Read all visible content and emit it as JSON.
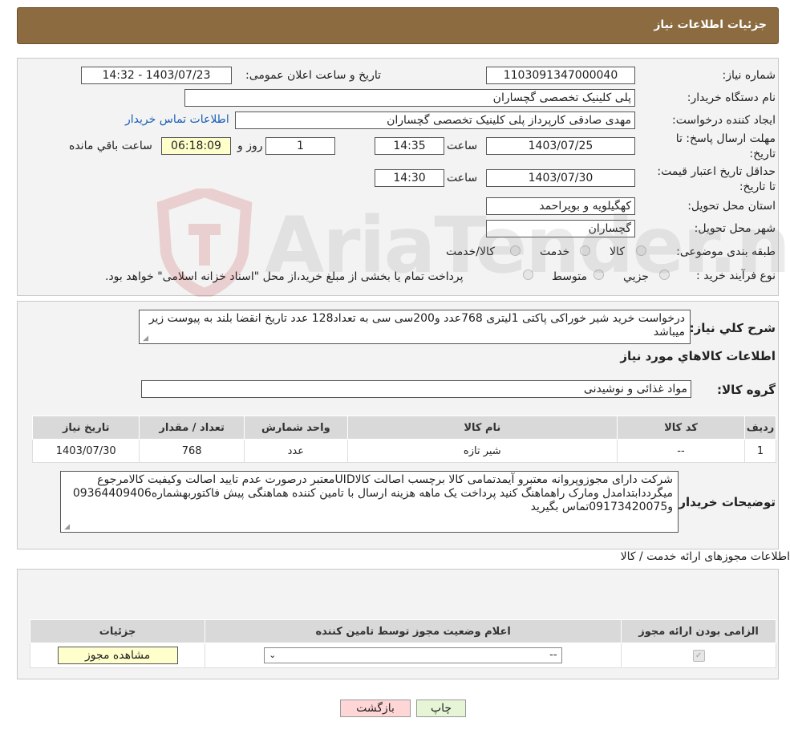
{
  "header": {
    "title": "جزئیات اطلاعات نیاز"
  },
  "info": {
    "need_number_label": "شماره نیاز:",
    "need_number": "1103091347000040",
    "announce_label": "تاریخ و ساعت اعلان عمومی:",
    "announce_value": "1403/07/23 - 14:32",
    "buyer_label": "نام دستگاه خریدار:",
    "buyer_value": "پلی کلینیک تخصصی گچساران",
    "creator_label": "ایجاد کننده درخواست:",
    "creator_value": "مهدی صادقی کارپرداز پلی کلینیک تخصصی گچساران",
    "contact_link": "اطلاعات تماس خریدار",
    "deadline_label": "مهلت ارسال پاسخ: تا تاریخ:",
    "deadline_date": "1403/07/25",
    "time_label": "ساعت",
    "deadline_time": "14:35",
    "days_value": "1",
    "days_label": "روز و",
    "remaining_value": "06:18:09",
    "remaining_label": "ساعت باقي مانده",
    "validity_label": "حداقل تاریخ اعتبار قیمت: تا تاریخ:",
    "validity_date": "1403/07/30",
    "validity_time": "14:30",
    "province_label": "استان محل تحویل:",
    "province_value": "کهگیلویه و بویراحمد",
    "city_label": "شهر محل تحویل:",
    "city_value": "گچساران",
    "category_label": "طبقه بندی موضوعی:",
    "cat_goods": "کالا",
    "cat_service": "خدمت",
    "cat_both": "کالا/خدمت",
    "process_label": "نوع فرآیند خرید :",
    "proc_partial": "جزیي",
    "proc_medium": "متوسط",
    "proc_note": "پرداخت تمام یا بخشی از مبلغ خرید،از محل \"اسناد خزانه اسلامی\" خواهد بود."
  },
  "summary": {
    "label": "شرح كلي نياز:",
    "text": "درخواست خرید شیر خوراکی پاکتی 1لیتری 768عدد و200سی سی به تعداد128 عدد تاریخ انقضا بلند به پیوست زیر میباشد",
    "goods_title": "اطلاعات کالاهاي مورد نياز",
    "group_label": "گروه کالا:",
    "group_value": "مواد غذائی و نوشیدنی"
  },
  "goods_table": {
    "headers": [
      "ردیف",
      "کد کالا",
      "نام کالا",
      "واحد شمارش",
      "تعداد / مقدار",
      "تاریخ نیاز"
    ],
    "rows": [
      [
        "1",
        "--",
        "شیر تازه",
        "عدد",
        "768",
        "1403/07/30"
      ]
    ]
  },
  "buyer_notes": {
    "label": "توضیحات خریدار:",
    "text": "شرکت دارای مجوزوپروانه معتبرو آیمدتمامی کالا برچسب اصالت کالاUIDمعتبر درصورت عدم تایید اصالت وکیفیت کالامرجوع میگرددابتدامدل ومارک راهماهنگ کنید پرداخت یک ماهه هزینه ارسال با تامین کننده هماهنگی پیش فاکتوربهشماره09364409406 و09173420075تماس بگیرید"
  },
  "permits": {
    "title": "اطلاعات مجوزهای ارائه خدمت / کالا",
    "headers": [
      "الزامی بودن ارائه مجوز",
      "اعلام وضعیت مجوز توسط تامین کننده",
      "جزئیات"
    ],
    "select_value": "--",
    "view_button": "مشاهده مجوز"
  },
  "buttons": {
    "print": "چاپ",
    "back": "بازگشت"
  },
  "watermark": {
    "text": "AriaTender.neT"
  },
  "colors": {
    "header_bg": "#8b6b3f",
    "link": "#1a5fb4",
    "back_btn": "#ffd6d6",
    "print_btn": "#e6f5d6"
  }
}
